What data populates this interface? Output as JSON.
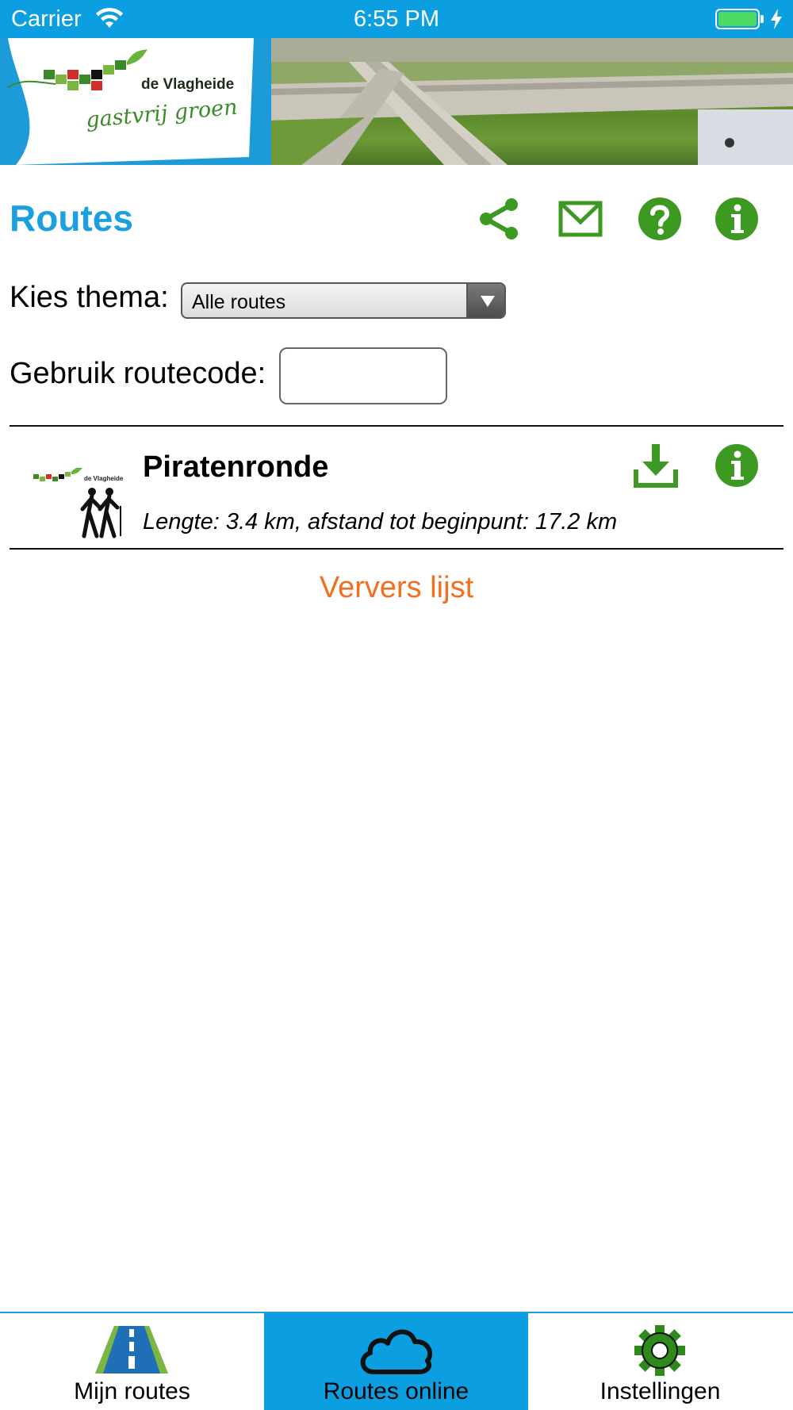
{
  "status_bar": {
    "carrier": "Carrier",
    "time": "6:55 PM"
  },
  "header": {
    "logo_name": "de Vlagheide",
    "logo_slogan": "gastvrij groen"
  },
  "page": {
    "title": "Routes"
  },
  "toolbar": {
    "icons": [
      "share-icon",
      "mail-icon",
      "help-icon",
      "info-icon"
    ]
  },
  "filters": {
    "theme_label": "Kies thema:",
    "theme_value": "Alle routes",
    "code_label": "Gebruik routecode:",
    "code_value": ""
  },
  "routes": [
    {
      "name": "Piratenronde",
      "meta": "Lengte: 3.4 km, afstand tot beginpunt: 17.2 km",
      "thumb_label": "de Vlagheide"
    }
  ],
  "refresh_label": "Ververs lijst",
  "tabs": [
    {
      "label": "Mijn routes",
      "icon": "road-icon",
      "active": false
    },
    {
      "label": "Routes online",
      "icon": "cloud-icon",
      "active": true
    },
    {
      "label": "Instellingen",
      "icon": "gear-icon",
      "active": false
    }
  ],
  "colors": {
    "brand_blue": "#0b9fe1",
    "title_blue": "#1a9fe0",
    "icon_green": "#3c9a22",
    "link_orange": "#f26f1f"
  }
}
